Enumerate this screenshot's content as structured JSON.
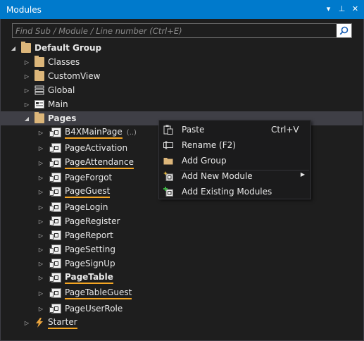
{
  "window": {
    "title": "Modules",
    "controls": [
      "▾",
      "⊥",
      "✕"
    ]
  },
  "search": {
    "placeholder": "Find Sub / Module / Line number (Ctrl+E)"
  },
  "tree": {
    "root": "Default Group",
    "items": [
      {
        "label": "Classes"
      },
      {
        "label": "CustomView"
      },
      {
        "label": "Global"
      },
      {
        "label": "Main"
      },
      {
        "label": "Pages"
      }
    ],
    "pages": [
      {
        "label": "B4XMainPage",
        "extra": "(..)"
      },
      {
        "label": "PageActivation"
      },
      {
        "label": "PageAttendance"
      },
      {
        "label": "PageForgot"
      },
      {
        "label": "PageGuest"
      },
      {
        "label": "PageLogin"
      },
      {
        "label": "PageRegister"
      },
      {
        "label": "PageReport"
      },
      {
        "label": "PageSetting"
      },
      {
        "label": "PageSignUp"
      },
      {
        "label": "PageTable"
      },
      {
        "label": "PageTableGuest"
      },
      {
        "label": "PageUserRole"
      }
    ],
    "starter": "Starter"
  },
  "context_menu": {
    "paste": "Paste",
    "paste_shortcut": "Ctrl+V",
    "rename": "Rename (F2)",
    "add_group": "Add Group",
    "add_new_module": "Add New Module",
    "add_existing": "Add Existing Modules"
  },
  "colors": {
    "titlebar": "#007acc",
    "background": "#1e1e1e",
    "underline": "#f5a623",
    "folder": "#dcb67a"
  }
}
